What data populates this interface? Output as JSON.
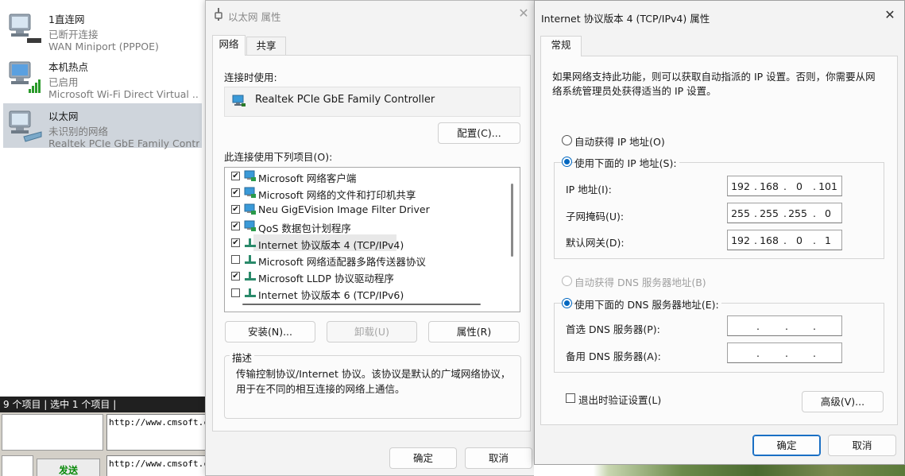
{
  "network_connections": {
    "items": [
      {
        "name": "1直连网",
        "status": "已断开连接",
        "device": "WAN Miniport (PPPOE)"
      },
      {
        "name": "本机热点",
        "status": "已启用",
        "device": "Microsoft Wi-Fi Direct Virtual ..."
      },
      {
        "name": "以太网",
        "status": "未识别的网络",
        "device": "Realtek PCIe GbE Family Contr..."
      }
    ],
    "status_bar": "9 个项目  |  选中 1 个项目  |"
  },
  "background_app": {
    "url_1": "http://www.cmsoft.cn",
    "url_2": "http://www.cmsoft.cn",
    "send_label": "发送"
  },
  "ethernet_dialog": {
    "title": "以太网 属性",
    "tabs": [
      {
        "label": "网络"
      },
      {
        "label": "共享"
      }
    ],
    "connect_using_label": "连接时使用:",
    "adapter_name": "Realtek PCIe GbE Family Controller",
    "configure_label": "配置(C)...",
    "items_label": "此连接使用下列项目(O):",
    "items": [
      {
        "label": "Microsoft 网络客户端",
        "checked": "✔"
      },
      {
        "label": "Microsoft 网络的文件和打印机共享",
        "checked": "✔"
      },
      {
        "label": "Neu GigEVision Image Filter Driver",
        "checked": "✔"
      },
      {
        "label": "QoS 数据包计划程序",
        "checked": "✔"
      },
      {
        "label": "Internet 协议版本 4 (TCP/IPv4)",
        "checked": "✔"
      },
      {
        "label": "Microsoft 网络适配器多路传送器协议",
        "checked": ""
      },
      {
        "label": "Microsoft LLDP 协议驱动程序",
        "checked": "✔"
      },
      {
        "label": "Internet 协议版本 6 (TCP/IPv6)",
        "checked": ""
      }
    ],
    "install_label": "安装(N)...",
    "uninstall_label": "卸载(U)",
    "properties_label": "属性(R)",
    "description_title": "描述",
    "description_text": "传输控制协议/Internet 协议。该协议是默认的广域网络协议，用于在不同的相互连接的网络上通信。",
    "ok_label": "确定",
    "cancel_label": "取消"
  },
  "ipv4_dialog": {
    "title": "Internet 协议版本 4 (TCP/IPv4) 属性",
    "tab_general": "常规",
    "intro": "如果网络支持此功能，则可以获取自动指派的 IP 设置。否则，你需要从网络系统管理员处获得适当的 IP 设置。",
    "auto_ip_label": "自动获得 IP 地址(O)",
    "manual_ip_label": "使用下面的 IP 地址(S):",
    "ip_address_label": "IP 地址(I):",
    "ip_address": [
      "192",
      "168",
      "0",
      "101"
    ],
    "subnet_label": "子网掩码(U):",
    "subnet": [
      "255",
      "255",
      "255",
      "0"
    ],
    "gateway_label": "默认网关(D):",
    "gateway": [
      "192",
      "168",
      "0",
      "1"
    ],
    "auto_dns_label": "自动获得 DNS 服务器地址(B)",
    "manual_dns_label": "使用下面的 DNS 服务器地址(E):",
    "preferred_dns_label": "首选 DNS 服务器(P):",
    "alternate_dns_label": "备用 DNS 服务器(A):",
    "validate_label": "退出时验证设置(L)",
    "advanced_label": "高级(V)...",
    "ok_label": "确定",
    "cancel_label": "取消"
  },
  "colors": {
    "accent": "#0067c0",
    "selection": "#cfd5dc",
    "dialog_bg": "#f3f3f3"
  }
}
